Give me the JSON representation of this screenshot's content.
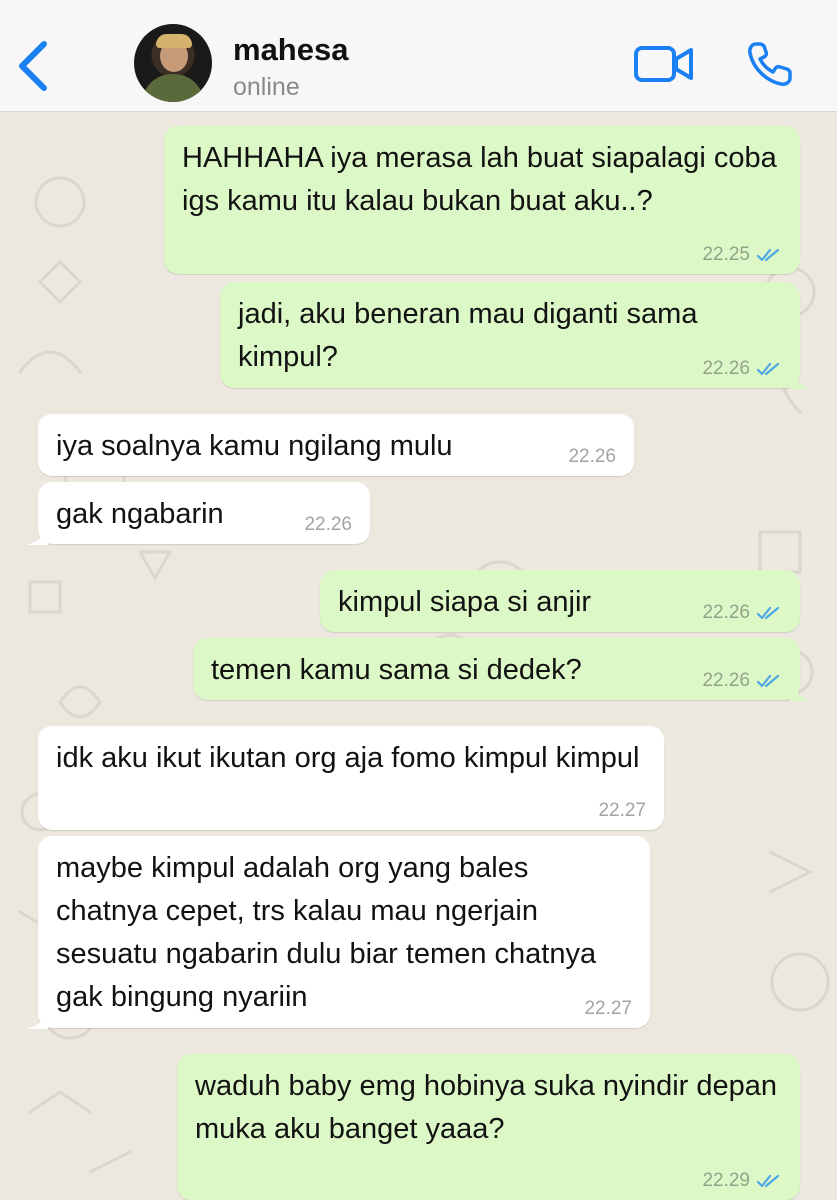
{
  "header": {
    "contact_name": "mahesa",
    "status": "online"
  },
  "colors": {
    "accent": "#1a80f3",
    "outgoing_bubble": "#dcf8c6",
    "incoming_bubble": "#ffffff",
    "chat_background": "#ece7df",
    "read_tick": "#4fa8e6"
  },
  "icons": {
    "back": "chevron-left-icon",
    "video": "video-camera-icon",
    "call": "phone-icon",
    "read": "double-check-icon"
  },
  "messages": [
    {
      "direction": "out",
      "text": "HAHHAHA iya merasa lah buat siapalagi coba igs kamu itu kalau bukan buat aku..?",
      "time": "22.25",
      "read": true
    },
    {
      "direction": "out",
      "text": "jadi, aku beneran mau diganti sama kimpul?",
      "time": "22.26",
      "read": true
    },
    {
      "direction": "in",
      "text": "iya soalnya kamu ngilang mulu",
      "time": "22.26"
    },
    {
      "direction": "in",
      "text": "gak ngabarin",
      "time": "22.26"
    },
    {
      "direction": "out",
      "text": "kimpul siapa si anjir",
      "time": "22.26",
      "read": true
    },
    {
      "direction": "out",
      "text": "temen kamu sama si dedek?",
      "time": "22.26",
      "read": true
    },
    {
      "direction": "in",
      "text": "idk aku ikut ikutan org aja fomo kimpul kimpul",
      "time": "22.27"
    },
    {
      "direction": "in",
      "text": "maybe kimpul adalah org yang bales chatnya cepet, trs kalau mau ngerjain sesuatu ngabarin dulu biar temen chatnya gak bingung nyariin",
      "time": "22.27"
    },
    {
      "direction": "out",
      "text": "waduh baby emg hobinya suka nyindir depan muka aku banget yaaa?",
      "time": "22.29",
      "read": true
    }
  ]
}
